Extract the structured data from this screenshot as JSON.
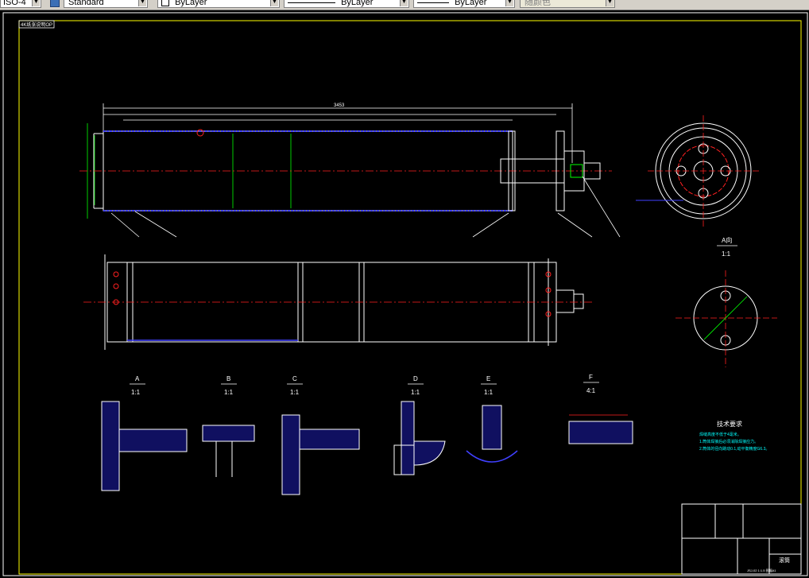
{
  "toolbar": {
    "text_style": "ISO-4",
    "table_style": "Standard",
    "layer_color": "ByLayer",
    "linetype": "ByLayer",
    "lineweight": "ByLayer",
    "plot_style": "随颜色"
  },
  "drawing": {
    "corner_tag": "4K纸张说明OP",
    "overall_length": "3453",
    "view_labels": {
      "a_view": "A向",
      "a_view_scale": "1:1",
      "details": [
        {
          "letter": "A",
          "scale": "1:1"
        },
        {
          "letter": "B",
          "scale": "1:1"
        },
        {
          "letter": "C",
          "scale": "1:1"
        },
        {
          "letter": "D",
          "scale": "1:1"
        },
        {
          "letter": "E",
          "scale": "1:1"
        },
        {
          "letter": "F",
          "scale": "4:1"
        }
      ]
    },
    "tech_req": {
      "title": "技术要求",
      "lines": [
        "焊缝高度不低于4毫米。",
        "1.筒体焊接后必须消除焊接应力。",
        "2.筒体的径向跳动0.1,动平衡精度G6.3。"
      ]
    },
    "title_block": {
      "part_name": "滚筒",
      "drawing_no": "JSJ-02 1:1.5 图幅A1"
    }
  }
}
